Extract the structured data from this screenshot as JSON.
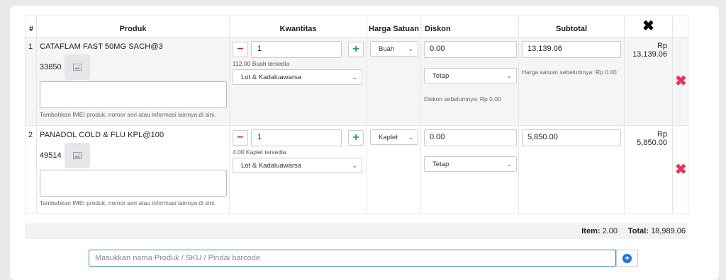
{
  "table": {
    "headers": {
      "num": "#",
      "product": "Produk",
      "quantity": "Kwantitas",
      "unit_price": "Harga Satuan",
      "discount": "Diskon",
      "subtotal": "Subtotal",
      "remove_all_icon": "close-icon"
    },
    "rows": [
      {
        "num": "1",
        "name": "CATAFLAM FAST 50MG SACH@3",
        "code": "33850",
        "imei_help": "Tambahkan IMEI produk, nomor seri atau informasi lainnya di sini.",
        "qty": "1",
        "stock": "112.00 Buah tersedia",
        "lot": "Lot & Kadaluawarsa",
        "unit": "Buah",
        "discount": "0.00",
        "discount_type": "Tetap",
        "discount_hint": "Diskon sebelumnya: Rp 0.00",
        "subtotal": "13,139.06",
        "price_hint": "Harga satuan sebelumnya: Rp 0.00",
        "row_total": "Rp 13,139.06"
      },
      {
        "num": "2",
        "name": "PANADOL COLD & FLU KPL@100",
        "code": "49514",
        "imei_help": "Tambahkan IMEI produk, nomor seri atau informasi lainnya di sini.",
        "qty": "1",
        "stock": "4.00 Kaplet tersedia",
        "lot": "Lot & Kadaluawarsa",
        "unit": "Kaplet",
        "discount": "0.00",
        "discount_type": "Tetap",
        "subtotal": "5,850.00",
        "row_total": "Rp 5,850.00"
      }
    ]
  },
  "summary": {
    "items_label": "Item:",
    "items_value": "2.00",
    "total_label": "Total:",
    "total_value": "18,989.06"
  },
  "search": {
    "placeholder": "Masukkan nama Produk / SKU / Pindai barcode"
  },
  "colors": {
    "delete": "#ee3354",
    "minus": "#e02424",
    "plus": "#21a366",
    "accent": "#1a73e8"
  }
}
